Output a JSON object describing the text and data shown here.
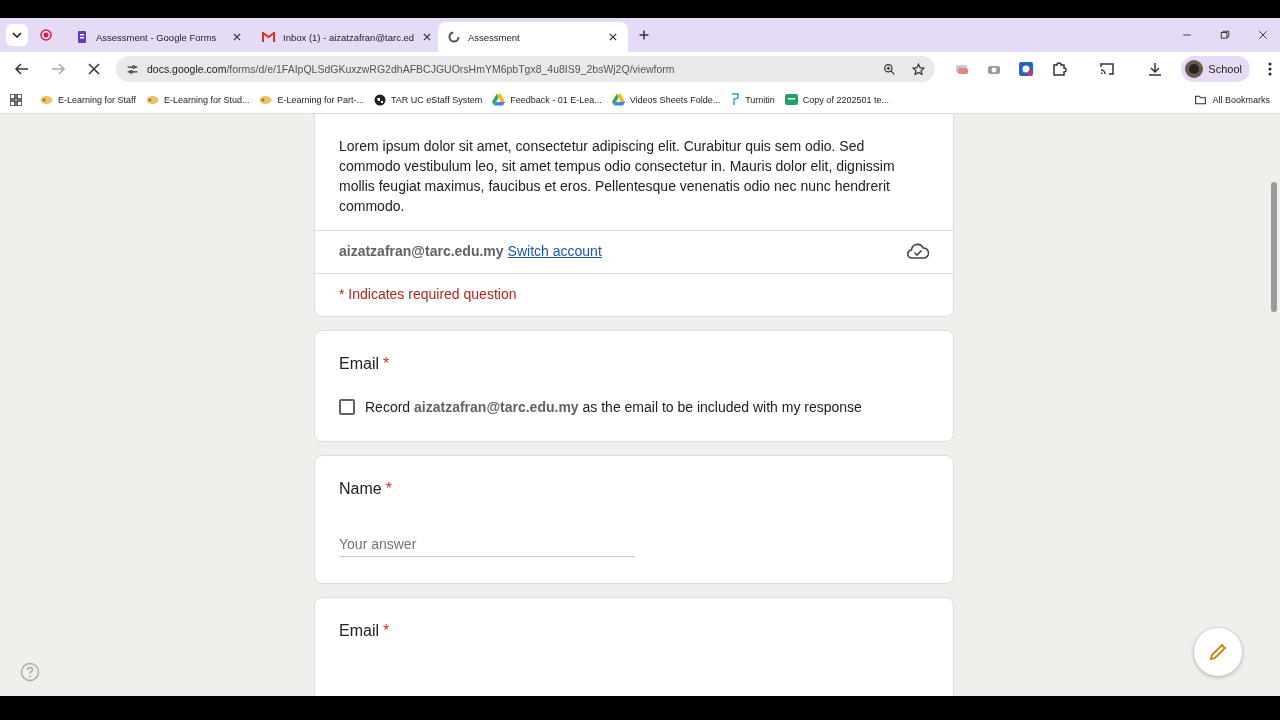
{
  "tabs": [
    {
      "title": "Assessment - Google Forms",
      "kind": "forms",
      "selected": false
    },
    {
      "title": "Inbox (1) - aizatzafran@tarc.ed",
      "kind": "mail",
      "selected": false
    },
    {
      "title": "Assessment",
      "kind": "loading",
      "selected": true
    }
  ],
  "address": {
    "host": "docs.google.com",
    "path": "/forms/d/e/1FAIpQLSdGKuxzwRG2dhAFBCJGUOrsHmYM6pbTgx8_4u8IS9_2bsWj2Q/viewform"
  },
  "profile": {
    "label": "School"
  },
  "bookmarks": [
    {
      "label": "E-Learning for Staff",
      "kind": "elearn"
    },
    {
      "label": "E-Learning for Stud...",
      "kind": "elearn"
    },
    {
      "label": "E-Learning for Part-...",
      "kind": "elearn"
    },
    {
      "label": "TAR UC eStaff System",
      "kind": "globe"
    },
    {
      "label": "Feedback - 01 E-Lea...",
      "kind": "drive"
    },
    {
      "label": "Videos Sheets Folde...",
      "kind": "drive"
    },
    {
      "label": "Turnitin",
      "kind": "turnitin"
    },
    {
      "label": "Copy of 2202501 te...",
      "kind": "sheet"
    }
  ],
  "all_bookmarks": "All Bookmarks",
  "form": {
    "description": "Lorem ipsum dolor sit amet, consectetur adipiscing elit. Curabitur quis sem odio. Sed commodo vestibulum leo, sit amet tempus odio consectetur in. Mauris dolor elit, dignissim mollis feugiat maximus, faucibus et eros. Pellentesque venenatis odio nec nunc hendrerit commodo.",
    "account": "aizatzafran@tarc.edu.my",
    "switch_account": "Switch account",
    "required_note": "* Indicates required question",
    "questions": [
      {
        "kind": "checkbox",
        "title": "Email",
        "required_mark": "*",
        "label": "Record **aizatzafran@tarc.edu.my** as the email to be included with my response",
        "checked": false
      },
      {
        "kind": "text",
        "title": "Name",
        "required_mark": "*",
        "placeholder": "Your answer"
      },
      {
        "kind": "partial",
        "title": "Email",
        "required_mark": "*"
      }
    ]
  }
}
